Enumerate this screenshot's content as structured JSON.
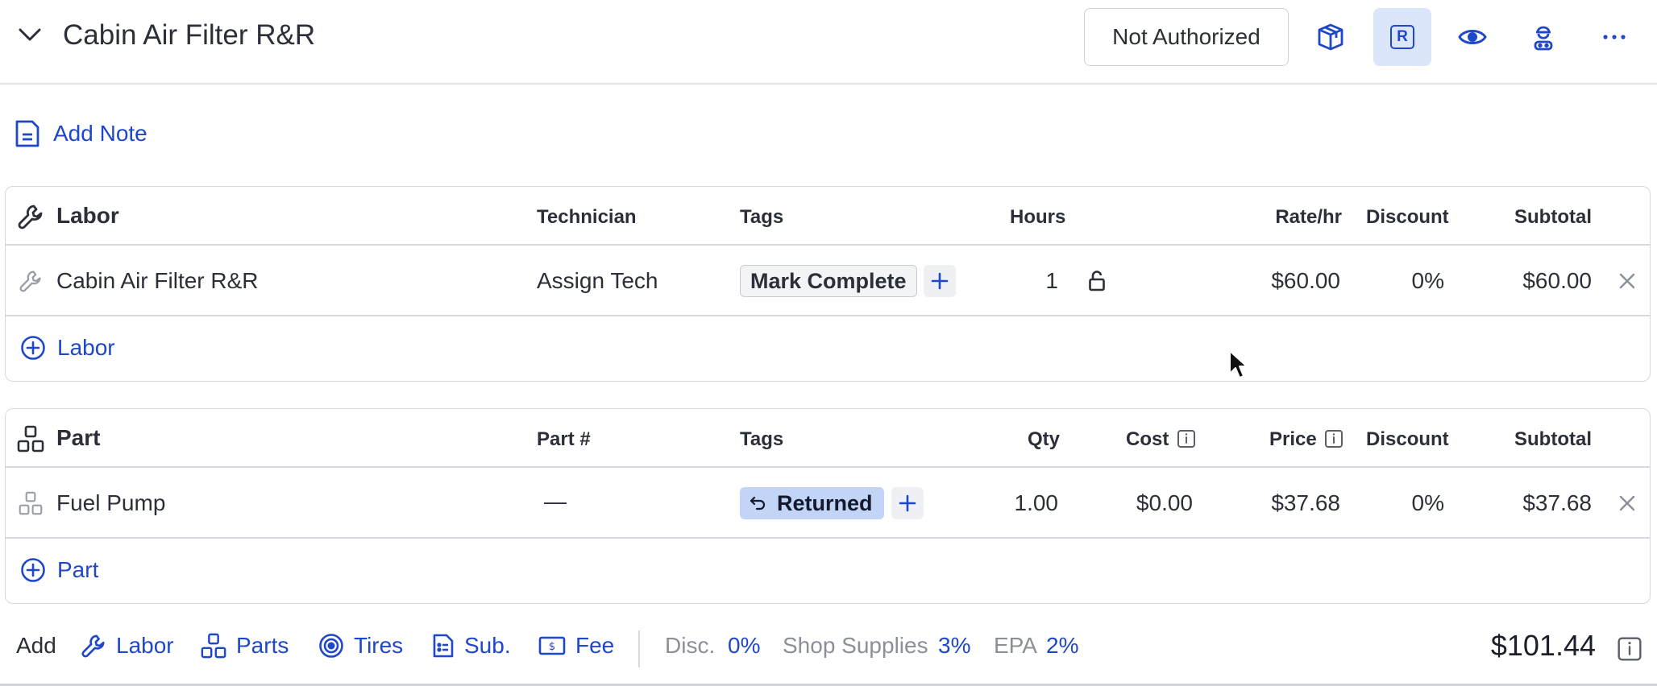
{
  "header": {
    "title": "Cabin Air Filter R&R",
    "authorization_button": "Not Authorized",
    "active_badge_letter": "R"
  },
  "add_note_label": "Add Note",
  "labor": {
    "headers": {
      "name": "Labor",
      "technician": "Technician",
      "tags": "Tags",
      "hours": "Hours",
      "rate": "Rate/hr",
      "discount": "Discount",
      "subtotal": "Subtotal"
    },
    "row": {
      "name": "Cabin Air Filter R&R",
      "technician": "Assign Tech",
      "tag": "Mark Complete",
      "hours": "1",
      "rate": "$60.00",
      "discount": "0%",
      "subtotal": "$60.00"
    },
    "add_label": "Labor"
  },
  "parts": {
    "headers": {
      "name": "Part",
      "part_number": "Part #",
      "tags": "Tags",
      "qty": "Qty",
      "cost": "Cost",
      "price": "Price",
      "discount": "Discount",
      "subtotal": "Subtotal"
    },
    "row": {
      "name": "Fuel Pump",
      "part_number": "—",
      "tag": "Returned",
      "qty": "1.00",
      "cost": "$0.00",
      "price": "$37.68",
      "discount": "0%",
      "subtotal": "$37.68"
    },
    "add_label": "Part"
  },
  "footer": {
    "add_label": "Add",
    "items": [
      "Labor",
      "Parts",
      "Tires",
      "Sub.",
      "Fee"
    ],
    "disc_label": "Disc.",
    "disc_value": "0%",
    "shop_supplies_label": "Shop Supplies",
    "shop_supplies_value": "3%",
    "epa_label": "EPA",
    "epa_value": "2%",
    "total": "$101.44"
  },
  "colors": {
    "accent": "#1f47c9",
    "active_button_bg": "#dbe6fb",
    "returned_tag_bg": "#c2d5f7",
    "border": "#d5d8de"
  },
  "icons": [
    "chevron-down-icon",
    "box-icon",
    "r-badge-icon",
    "eye-icon",
    "technician-icon",
    "more-icon",
    "note-icon",
    "wrench-icon",
    "parts-icon",
    "plus-circle-icon",
    "lock-icon",
    "close-icon",
    "return-icon",
    "info-icon",
    "tire-icon",
    "sublet-icon",
    "fee-icon",
    "cursor-icon"
  ]
}
